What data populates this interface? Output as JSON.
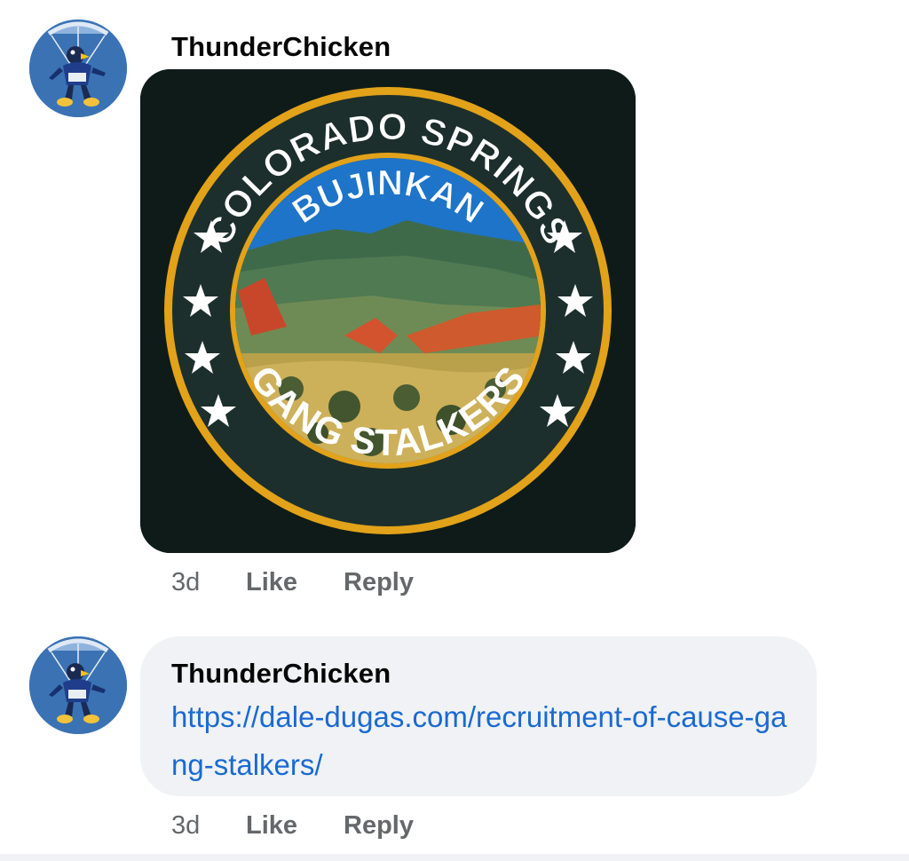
{
  "comments": [
    {
      "author": "ThunderChicken",
      "sticker": {
        "top_text": "COLORADO SPRINGS",
        "middle_text": "BUJINKAN",
        "bottom_text": "GANG STALKERS"
      },
      "time": "3d",
      "like_label": "Like",
      "reply_label": "Reply"
    },
    {
      "author": "ThunderChicken",
      "link_text": "https://dale-dugas.com/recruitment-of-cause-gang-stalkers/",
      "time": "3d",
      "like_label": "Like",
      "reply_label": "Reply"
    }
  ],
  "colors": {
    "link": "#1a6ad1",
    "bubble": "#f0f2f5",
    "meta": "#65676b",
    "badge_ring": "#e2a21a",
    "badge_bg": "#0f1b18"
  },
  "icons": {
    "avatar": "parachuting-bird-mascot",
    "star": "white-star"
  }
}
